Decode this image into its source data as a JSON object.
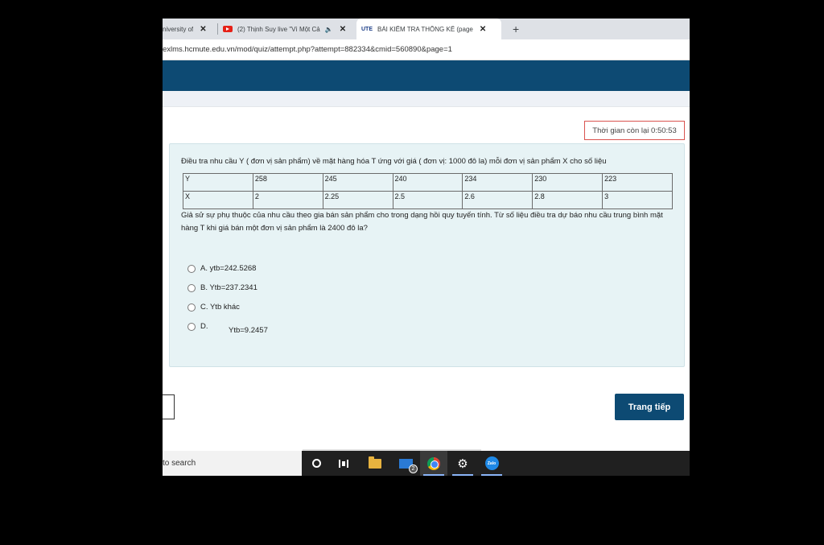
{
  "browser": {
    "tabs": [
      {
        "title": "niversity of",
        "close": "✕",
        "active": false
      },
      {
        "title": "(2) Thịnh Suy live \"Vì Một Cả",
        "close": "✕",
        "active": false,
        "icon": "youtube-icon"
      },
      {
        "title": "BÀI KIỂM TRA THỐNG KÊ (page",
        "close": "✕",
        "active": true,
        "icon": "ute-logo-icon"
      }
    ],
    "new_tab": "+",
    "address": "exlms.hcmute.edu.vn/mod/quiz/attempt.php?attempt=882334&cmid=560890&page=1"
  },
  "quiz": {
    "timer": "Thời gian còn lại 0:50:53",
    "question_intro": "Điều tra nhu cầu Y ( đơn vị sản phẩm) về mặt hàng hóa  T  ứng với giá ( đơn vị: 1000 đô la) mỗi đơn vị sản phẩm  X  cho số liệu",
    "table": {
      "rows": [
        [
          "Y",
          "258",
          "245",
          "240",
          "234",
          "230",
          "223"
        ],
        [
          "X",
          "2",
          "2.25",
          "2.5",
          "2.6",
          "2.8",
          "3"
        ]
      ]
    },
    "question_body": " Giả sử sự phụ thuộc của nhu cầu theo gia bán sản phẩm  cho trong dạng hồi quy tuyến tính. Từ số liệu điều tra dự báo  nhu cầu trung bình mặt hàng T khi giá bán một đơn vị sản phẩm là 2400 đô la?",
    "options": [
      {
        "label": "A. ytb=242.5268"
      },
      {
        "label": "B. Ytb=237.2341"
      },
      {
        "label": "C. Ytb khác"
      },
      {
        "label": "D."
      }
    ],
    "option_d_value": "Ytb=9.2457",
    "next_button": "Trang tiếp"
  },
  "taskbar": {
    "search_placeholder": "to search",
    "mail_badge": "2",
    "zalo_label": "Zalo"
  },
  "colors": {
    "header": "#0d4a73",
    "panel": "#e7f3f5",
    "timer_border": "#d9534f"
  }
}
